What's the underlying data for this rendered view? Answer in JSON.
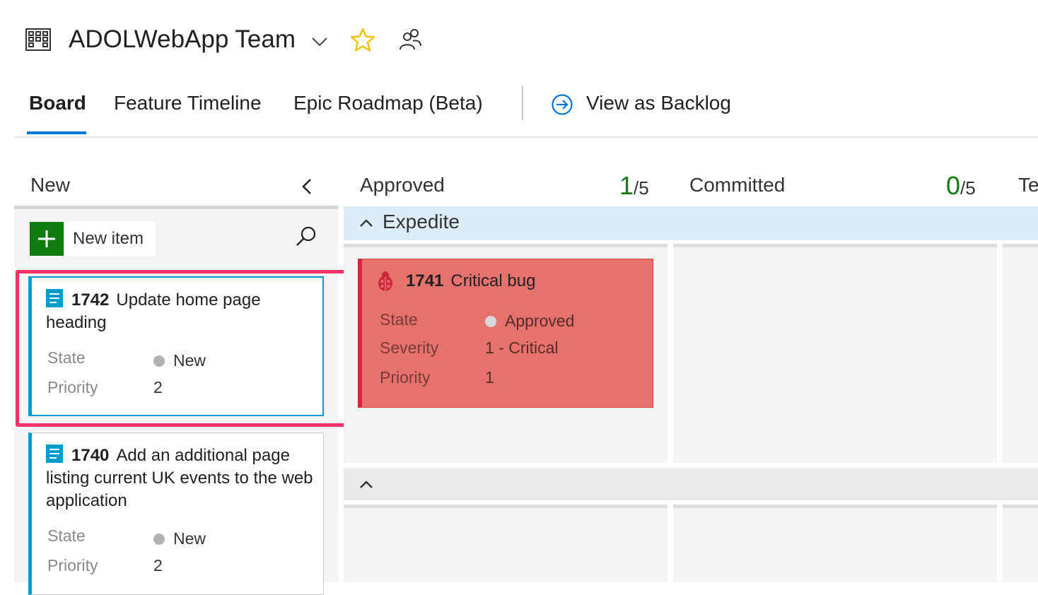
{
  "header": {
    "team_name": "ADOLWebApp Team"
  },
  "tabs": [
    {
      "label": "Board",
      "active": true
    },
    {
      "label": "Feature Timeline",
      "active": false
    },
    {
      "label": "Epic Roadmap (Beta)",
      "active": false
    },
    {
      "label": "View as Backlog",
      "active": false
    }
  ],
  "columns": {
    "new": {
      "title": "New"
    },
    "approved": {
      "title": "Approved",
      "count": "1",
      "limit": "/5"
    },
    "committed": {
      "title": "Committed",
      "count": "0",
      "limit": "/5"
    },
    "next_partial": {
      "title": "Te"
    }
  },
  "new_item": {
    "label": "New item"
  },
  "swimlane": {
    "title": "Expedite"
  },
  "cards": [
    {
      "id": "1742",
      "title": "Update home page heading",
      "state_label": "State",
      "state": "New",
      "priority_label": "Priority",
      "priority": "2"
    },
    {
      "id": "1740",
      "title": "Add an additional page listing current UK events to the web application",
      "state_label": "State",
      "state": "New",
      "priority_label": "Priority",
      "priority": "2"
    }
  ],
  "bug_card": {
    "id": "1741",
    "title": "Critical bug",
    "state_label": "State",
    "state": "Approved",
    "severity_label": "Severity",
    "severity": "1 - Critical",
    "priority_label": "Priority",
    "priority": "1"
  },
  "colors": {
    "accent": "#0078d4",
    "wip_count": "#107c10",
    "story": "#009ccc",
    "bug_card": "#e6726e",
    "highlight": "#f2336a",
    "expedite_lane": "#deecf9"
  },
  "icons": [
    "board-icon",
    "chevron-down-icon",
    "star-icon",
    "people-icon",
    "arrow-circle-icon",
    "chevron-left-icon",
    "plus-icon",
    "search-icon",
    "user-story-icon",
    "bug-icon",
    "chevron-up-icon"
  ]
}
